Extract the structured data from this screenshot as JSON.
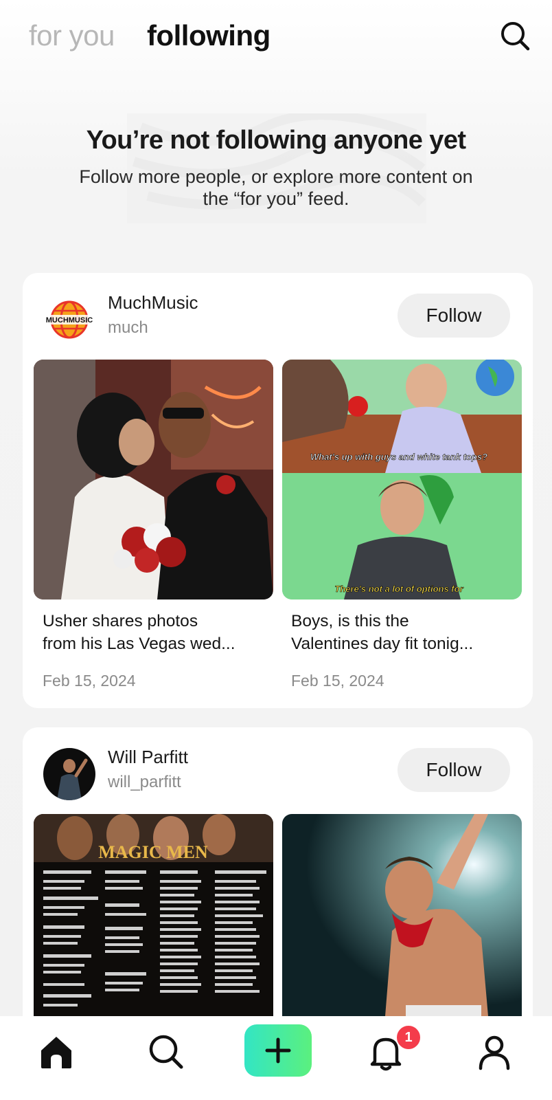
{
  "header": {
    "tab_for_you": "for you",
    "tab_following": "following",
    "search_icon": "search-icon"
  },
  "empty_state": {
    "title": "You’re not following anyone yet",
    "subtitle": "Follow more people, or explore more content on the “for you” feed."
  },
  "suggestions": [
    {
      "name": "MuchMusic",
      "handle": "much",
      "avatar_text": "MUCHMUSIC",
      "follow_label": "Follow",
      "posts": [
        {
          "title": "Usher shares photos\nfrom his Las Vegas wed...",
          "date": "Feb 15, 2024"
        },
        {
          "title": "Boys, is this the\nValentines day fit tonig...",
          "date": "Feb 15, 2024",
          "caption_top": "What's up with guys and white tank tops?",
          "caption_bottom": "There's not a lot of options for"
        }
      ]
    },
    {
      "name": "Will Parfitt",
      "handle": "will_parfitt",
      "follow_label": "Follow",
      "posts": [
        {
          "poster_title": "MAGIC MEN"
        },
        {}
      ]
    }
  ],
  "bottom_nav": {
    "items": [
      "home-icon",
      "search-icon",
      "create-plus-icon",
      "bell-icon",
      "profile-icon"
    ],
    "notification_count": "1",
    "accent": "#3ae8b0",
    "badge_color": "#f43c4b"
  }
}
